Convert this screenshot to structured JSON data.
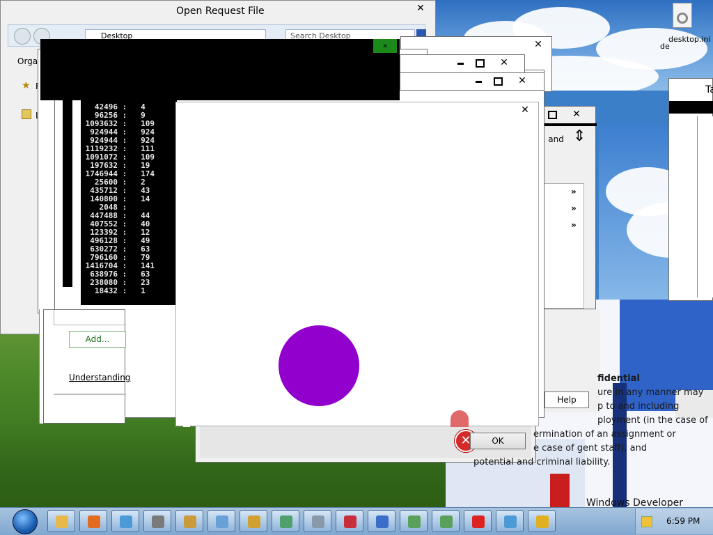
{
  "desktop": {
    "icon_label_1": "desktop.ini",
    "icon_label_2": "de",
    "watermark": "Windows Developer Preview"
  },
  "open_dialog": {
    "title": "Open Request File",
    "location": "Desktop",
    "search_placeholder": "Search Desktop",
    "organize_label": "Organ",
    "nav_f": "F",
    "nav_l": "L"
  },
  "console": {
    "rows": [
      [
        "42496",
        "4"
      ],
      [
        "96256",
        "9"
      ],
      [
        "1093632",
        "109"
      ],
      [
        "924944",
        "924"
      ],
      [
        "924944",
        "924"
      ],
      [
        "1119232",
        "111"
      ],
      [
        "1091072",
        "109"
      ],
      [
        "197632",
        "19"
      ],
      [
        "1746944",
        "174"
      ],
      [
        "25600",
        "2"
      ],
      [
        "435712",
        "43"
      ],
      [
        "140800",
        "14"
      ],
      [
        "2048",
        ""
      ],
      [
        "447488",
        "44"
      ],
      [
        "407552",
        "40"
      ],
      [
        "123392",
        "12"
      ],
      [
        "496128",
        "49"
      ],
      [
        "630272",
        "63"
      ],
      [
        "796160",
        "79"
      ],
      [
        "1416704",
        "141"
      ],
      [
        "638976",
        "63"
      ],
      [
        "238080",
        "23"
      ],
      [
        "18432",
        "1"
      ]
    ]
  },
  "settings_panel": {
    "add_button": "Add...",
    "understanding_link": "Understanding",
    "help_button": "Help",
    "text_fragment": "il, and"
  },
  "confidential": {
    "heading": "fidential",
    "lines": [
      "ure in any manner may",
      "p to and including",
      "ployment (in the case of",
      "ermination of an assignment or",
      "e case of   gent staff), and",
      "potential and criminal liability."
    ]
  },
  "error_dialog": {
    "ok_label": "OK"
  },
  "partial_window": {
    "title_fragment": "Ta"
  },
  "taskbar": {
    "clock": "6:59 PM",
    "items": [
      "Start",
      "Explorer",
      "Firefox",
      "Chrome",
      "Network",
      "Users",
      "Calculator",
      "Settings",
      "Window",
      "Printer",
      "Paint",
      "Remote",
      "Window",
      "Window",
      "Error",
      "Chrome",
      "Search"
    ]
  },
  "colors": {
    "circle": "#9100cc",
    "console_bg": "#000000",
    "accent_green": "#1b8a1b"
  }
}
